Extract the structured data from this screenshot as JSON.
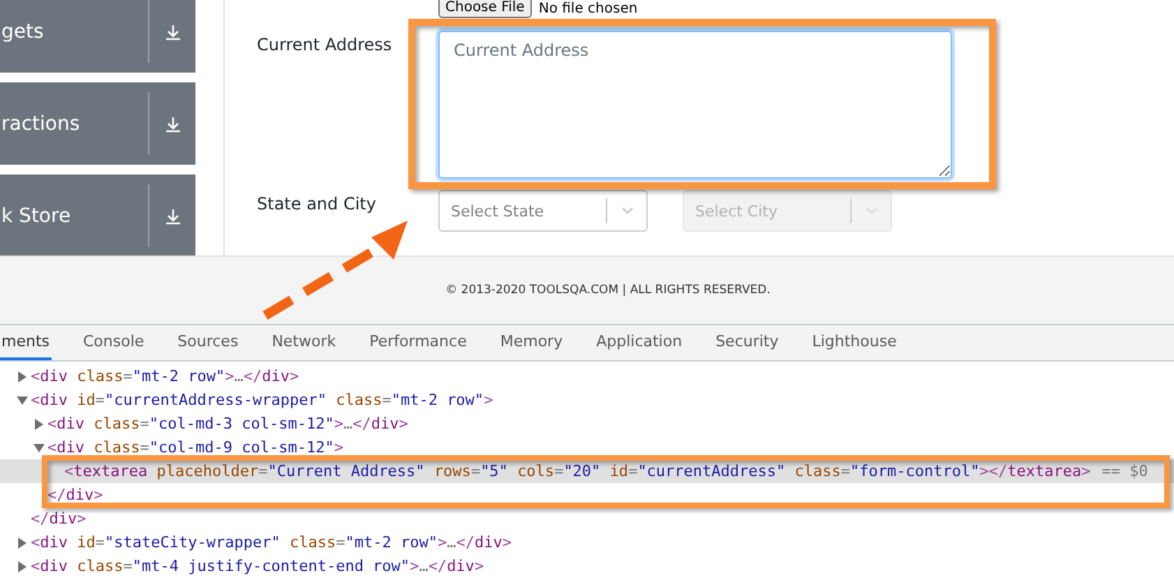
{
  "sidebar": {
    "items": [
      {
        "label": "gets"
      },
      {
        "label": "ractions"
      },
      {
        "label": "k Store"
      }
    ]
  },
  "form": {
    "file_button": "Choose File",
    "file_status": "No file chosen",
    "rows": [
      {
        "label": "Current Address",
        "kind": "textarea",
        "placeholder": "Current Address"
      },
      {
        "label": "State and City",
        "kind": "selects",
        "selects": [
          {
            "placeholder": "Select State",
            "disabled": false
          },
          {
            "placeholder": "Select City",
            "disabled": true
          }
        ]
      }
    ]
  },
  "footer": {
    "text": "© 2013-2020 TOOLSQA.COM | ALL RIGHTS RESERVED."
  },
  "devtools": {
    "tabs": [
      {
        "label": "ments",
        "selected": true
      },
      {
        "label": "Console",
        "selected": false
      },
      {
        "label": "Sources",
        "selected": false
      },
      {
        "label": "Network",
        "selected": false
      },
      {
        "label": "Performance",
        "selected": false
      },
      {
        "label": "Memory",
        "selected": false
      },
      {
        "label": "Application",
        "selected": false
      },
      {
        "label": "Security",
        "selected": false
      },
      {
        "label": "Lighthouse",
        "selected": false
      }
    ],
    "tree": [
      {
        "text": "<div class=\"mt-2 row\">…</div>",
        "expanded": false,
        "selected": false
      },
      {
        "text": "<div id=\"currentAddress-wrapper\" class=\"mt-2 row\">",
        "expanded": true,
        "selected": false,
        "closing": "</div>",
        "children": [
          {
            "text": "<div class=\"col-md-3 col-sm-12\">…</div>",
            "expanded": false,
            "selected": false
          },
          {
            "text": "<div class=\"col-md-9 col-sm-12\">",
            "expanded": true,
            "selected": false,
            "closing": "</div>",
            "children": [
              {
                "text": "<textarea placeholder=\"Current Address\" rows=\"5\" cols=\"20\" id=\"currentAddress\" class=\"form-control\"></textarea>",
                "selected": true,
                "console_ref": "== $0"
              }
            ]
          }
        ]
      },
      {
        "text": "<div id=\"stateCity-wrapper\" class=\"mt-2 row\">…</div>",
        "expanded": false,
        "selected": false
      },
      {
        "text": "<div class=\"mt-4 justify-content-end row\">…</div>",
        "expanded": false,
        "selected": false
      }
    ]
  }
}
